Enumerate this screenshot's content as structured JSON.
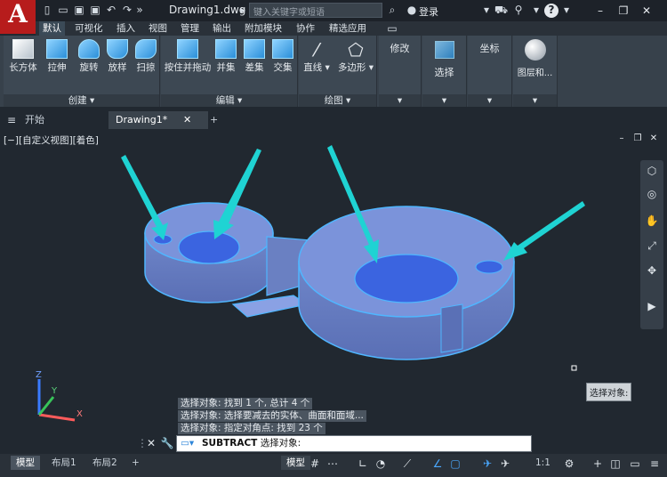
{
  "title_bar": {
    "app_letter": "A",
    "doc_title": "Drawing1.dwg",
    "search_placeholder": "键入关键字或短语",
    "login_label": "登录",
    "help_label": "?"
  },
  "ribbon_tabs": [
    "默认",
    "可视化",
    "插入",
    "视图",
    "管理",
    "输出",
    "附加模块",
    "协作",
    "精选应用"
  ],
  "ribbon": {
    "create": {
      "label": "创建",
      "buttons": [
        "长方体",
        "拉伸",
        "旋转",
        "放样",
        "扫掠"
      ]
    },
    "edit": {
      "label": "编辑",
      "buttons": [
        "按住并拖动",
        "并集",
        "差集",
        "交集"
      ]
    },
    "draw": {
      "label": "绘图",
      "buttons": [
        "直线",
        "多边形"
      ]
    },
    "modify": {
      "label": "修改"
    },
    "select": {
      "label": "选择"
    },
    "coords": {
      "label": "坐标"
    },
    "layers": {
      "label": "图层和..."
    }
  },
  "file_tabs": {
    "start": "开始",
    "drawing": "Drawing1*",
    "add": "+"
  },
  "viewport": {
    "label": "[−][自定义视图][着色]"
  },
  "command_history": [
    "选择对象: 找到 1 个, 总计 4 个",
    "选择对象:  选择要减去的实体、曲面和面域...",
    "选择对象: 指定对角点: 找到 23 个"
  ],
  "tooltip": "选择对象:",
  "command_input": {
    "command": "SUBTRACT",
    "prompt": "选择对象:"
  },
  "status_bar": {
    "tabs": [
      "模型",
      "布局1",
      "布局2"
    ],
    "add": "+",
    "model_button": "模型",
    "scale": "1:1"
  },
  "colors": {
    "accent": "#4aa8ff",
    "arrow": "#1fd3d3",
    "app_red": "#b71c1c"
  }
}
